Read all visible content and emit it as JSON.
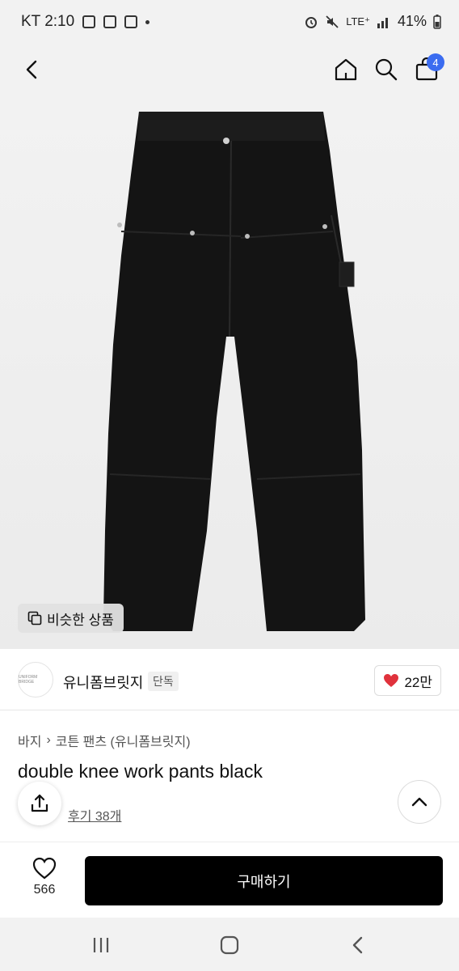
{
  "status_bar": {
    "carrier_time": "KT 2:10",
    "network": "LTE⁺",
    "battery": "41%"
  },
  "header": {
    "cart_count": "4"
  },
  "image": {
    "similar_label": "비슷한 상품"
  },
  "brand": {
    "logo_text": "UNIFORM BRIDGE",
    "name": "유니폼브릿지",
    "tag": "단독",
    "likes": "22만"
  },
  "product": {
    "breadcrumb": [
      "바지",
      "코튼 팬츠 (유니폼브릿지)"
    ],
    "title": "double knee work pants black",
    "reviews": "후기 38개"
  },
  "bottom_bar": {
    "wish_count": "566",
    "buy_label": "구매하기"
  },
  "colors": {
    "badge": "#3b6cf0",
    "heart": "#e0323c",
    "buy_button": "#000000",
    "review_star": "#f2b705"
  },
  "icons": [
    "back-arrow-icon",
    "home-icon",
    "search-icon",
    "cart-icon",
    "copy-icon",
    "heart-icon",
    "share-icon",
    "chevron-up-icon",
    "recent-apps-icon",
    "home-nav-icon",
    "back-nav-icon"
  ]
}
